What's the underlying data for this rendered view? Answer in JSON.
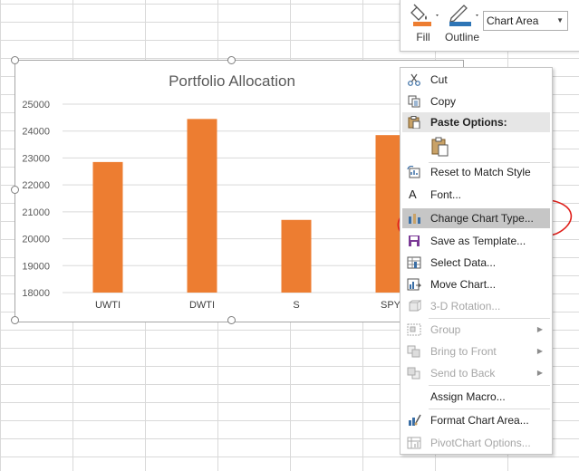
{
  "chart": {
    "chart_data": {
      "type": "bar",
      "title": "Portfolio Allocation",
      "categories": [
        "UWTI",
        "DWTI",
        "S",
        "SPY"
      ],
      "values": [
        22850,
        24450,
        20700,
        23850
      ],
      "ylim": [
        18000,
        25000
      ],
      "yticks": [
        18000,
        19000,
        20000,
        21000,
        22000,
        23000,
        24000,
        25000
      ],
      "gridlines": true,
      "bar_color": "#ed7d31"
    }
  },
  "toolbar": {
    "fill_label": "Fill",
    "outline_label": "Outline",
    "chart_elements_value": "Chart Area",
    "fill_color": "#ed7d31",
    "outline_color": "#2e75b6"
  },
  "menu": {
    "cut": "Cut",
    "copy": "Copy",
    "paste_options": "Paste Options:",
    "reset_style": "Reset to Match Style",
    "font": "Font...",
    "change_chart_type": "Change Chart Type...",
    "save_template": "Save as Template...",
    "select_data": "Select Data...",
    "move_chart": "Move Chart...",
    "rotation_3d": "3-D Rotation...",
    "group": "Group",
    "bring_front": "Bring to Front",
    "send_back": "Send to Back",
    "assign_macro": "Assign Macro...",
    "format_chart_area": "Format Chart Area...",
    "pivotchart_options": "PivotChart Options..."
  }
}
